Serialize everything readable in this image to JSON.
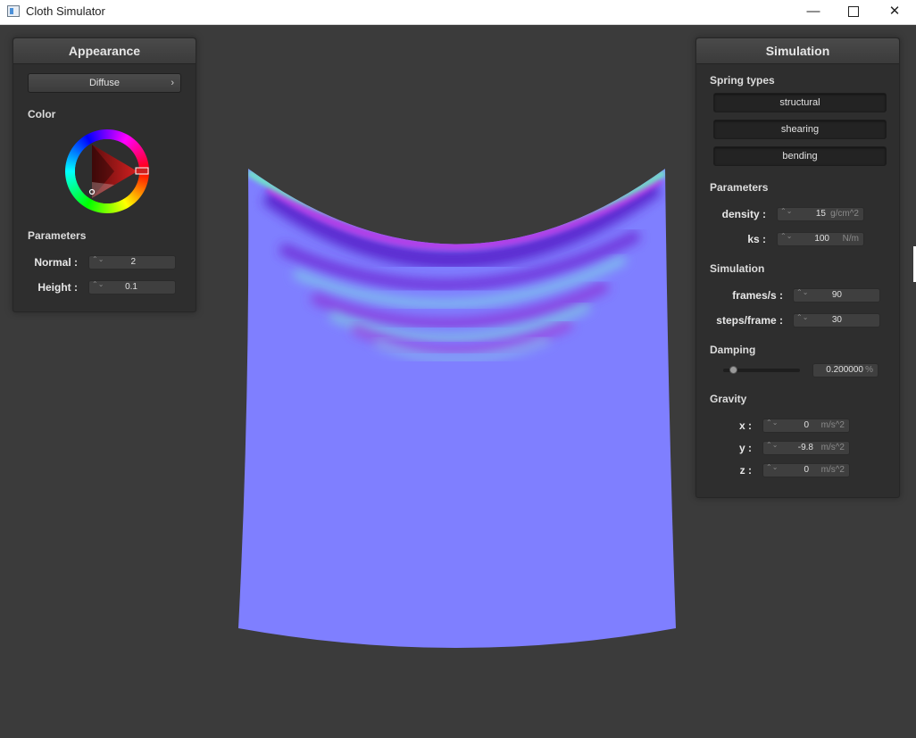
{
  "window": {
    "title": "Cloth Simulator",
    "minimize_glyph": "—",
    "close_glyph": "✕"
  },
  "appearance": {
    "title": "Appearance",
    "shader": {
      "value": "Diffuse",
      "chevron": "›"
    },
    "color_label": "Color",
    "color_value": "#cc2020",
    "parameters_label": "Parameters",
    "normal": {
      "label": "Normal :",
      "value": "2"
    },
    "height": {
      "label": "Height :",
      "value": "0.1"
    }
  },
  "simulation": {
    "title": "Simulation",
    "spring_types_label": "Spring types",
    "springs": [
      "structural",
      "shearing",
      "bending"
    ],
    "parameters_label": "Parameters",
    "density": {
      "label": "density :",
      "value": "15",
      "unit": "g/cm^2"
    },
    "ks": {
      "label": "ks :",
      "value": "100",
      "unit": "N/m"
    },
    "simulation_label": "Simulation",
    "frames": {
      "label": "frames/s :",
      "value": "90"
    },
    "steps": {
      "label": "steps/frame :",
      "value": "30"
    },
    "damping_label": "Damping",
    "damping": {
      "value": "0.200000",
      "unit": "%",
      "fraction": 0.2
    },
    "gravity_label": "Gravity",
    "gx": {
      "label": "x :",
      "value": "0",
      "unit": "m/s^2"
    },
    "gy": {
      "label": "y :",
      "value": "-9.8",
      "unit": "m/s^2"
    },
    "gz": {
      "label": "z :",
      "value": "0",
      "unit": "m/s^2"
    }
  },
  "spinner_glyph": "⌃⌄",
  "colors": {
    "background": "#3b3b3b",
    "cloth": "#7f7fff",
    "fold_purple": "#6a2ed6",
    "fold_magenta": "#b43ee6",
    "fold_cyan": "#73e6c8"
  }
}
